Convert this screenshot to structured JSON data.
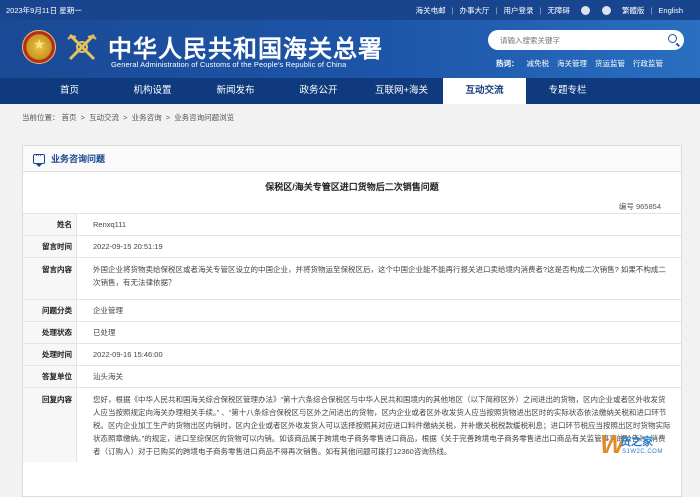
{
  "topbar": {
    "date": "2023年9月11日 星期一",
    "links": [
      "海关电邮",
      "办事大厅",
      "用户登录",
      "无障碍",
      "繁體版",
      "English"
    ]
  },
  "header": {
    "title": "中华人民共和国海关总署",
    "subtitle": "General Administration of Customs of the People's Republic of China",
    "search_placeholder": "请输入搜索关键字",
    "hot_label": "热词：",
    "hot_words": [
      "减免税",
      "海关管理",
      "货运监管",
      "行政监管"
    ]
  },
  "nav": {
    "items": [
      "首页",
      "机构设置",
      "新闻发布",
      "政务公开",
      "互联网+海关",
      "互动交流",
      "专题专栏"
    ],
    "active_index": 5
  },
  "breadcrumb": {
    "label": "当前位置：",
    "items": [
      "首页",
      "互动交流",
      "业务咨询",
      "业务咨询问题浏览"
    ],
    "separator": " > "
  },
  "panel": {
    "header_title": "业务咨询问题",
    "question_title": "保税区/海关专管区进口货物后二次销售问题",
    "number_label": "编号",
    "number_value": "965854",
    "fields": {
      "name_label": "姓名",
      "name_value": "Renxq111",
      "time_label": "留言时间",
      "time_value": "2022-09-15 20:51:19",
      "content_label": "留言内容",
      "content_value": "外国企业将货物卖给保税区或者海关专管区设立的中国企业，并将货物运至保税区后，这个中国企业能不能再行报关进口卖给境内消费者?这是否构成二次销售? 如果不构成二次销售，有无法律依据？",
      "category_label": "问题分类",
      "category_value": "企业管理",
      "status_label": "处理状态",
      "status_value": "已处理",
      "process_time_label": "处理时间",
      "process_time_value": "2022-09-16 15:46:00",
      "unit_label": "答复单位",
      "unit_value": "汕头海关",
      "reply_label": "回复内容",
      "reply_value": "您好，根据《中华人民共和国海关综合保税区管理办法》“第十六条综合保税区与中华人民共和国境内的其他地区（以下简称区外）之间进出的货物，区内企业或者区外收发货人应当按照规定向海关办理相关手续。” 、“第十八条综合保税区与区外之间进出的货物，区内企业或者区外收发货人应当按照货物进出区时的实际状态依法缴纳关税和进口环节税。区内企业加工生产的货物出区内销时，区内企业或者区外收发货人可以选择按照其对应进口料件缴纳关税，并补缴关税税款缓税利息；进口环节税应当按照出区时货物实际状态照章缴纳。”的规定，进口至综保区的货物可以内销。如该商品属于跨境电子商务零售进口商品，根据《关于完善跨境电子商务零售进出口商品有关监管事宜的公告》，消费者（订购人）对于已购买的跨境电子商务零售进口商品不得再次销售。如有其他问题可拨打12360咨询热线。"
    }
  },
  "watermark": {
    "text": "货之家",
    "sub": "S1W2C.COM"
  },
  "colors": {
    "brand_blue": "#19458f",
    "nav_blue": "#0f3a7d",
    "watermark_orange": "#e08a2a"
  }
}
